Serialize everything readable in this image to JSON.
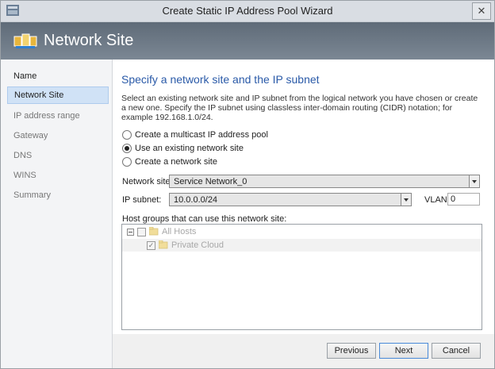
{
  "window": {
    "title": "Create Static IP Address Pool Wizard",
    "close_glyph": "✕"
  },
  "banner": {
    "title": "Network Site"
  },
  "sidebar": {
    "items": [
      {
        "label": "Name"
      },
      {
        "label": "Network Site"
      },
      {
        "label": "IP address range"
      },
      {
        "label": "Gateway"
      },
      {
        "label": "DNS"
      },
      {
        "label": "WINS"
      },
      {
        "label": "Summary"
      }
    ]
  },
  "main": {
    "heading": "Specify a network site and the IP subnet",
    "description": "Select an existing network site and IP subnet from the logical network you have chosen or create a new one. Specify the IP subnet using classless inter-domain routing (CIDR) notation; for example 192.168.1.0/24.",
    "options": [
      {
        "label": "Create a multicast IP address pool",
        "selected": false
      },
      {
        "label": "Use an existing network site",
        "selected": true
      },
      {
        "label": "Create a network site",
        "selected": false
      }
    ],
    "network_site": {
      "label": "Network site:",
      "value": "Service Network_0"
    },
    "ip_subnet": {
      "label": "IP subnet:",
      "value": "10.0.0.0/24"
    },
    "vlan": {
      "label": "VLAN:",
      "value": "0"
    },
    "host_groups": {
      "label": "Host groups that can use this network site:",
      "tree": [
        {
          "label": "All Hosts",
          "checked": false
        },
        {
          "label": "Private Cloud",
          "checked": true,
          "check_glyph": "✓"
        }
      ]
    }
  },
  "footer": {
    "previous": "Previous",
    "next": "Next",
    "cancel": "Cancel"
  }
}
